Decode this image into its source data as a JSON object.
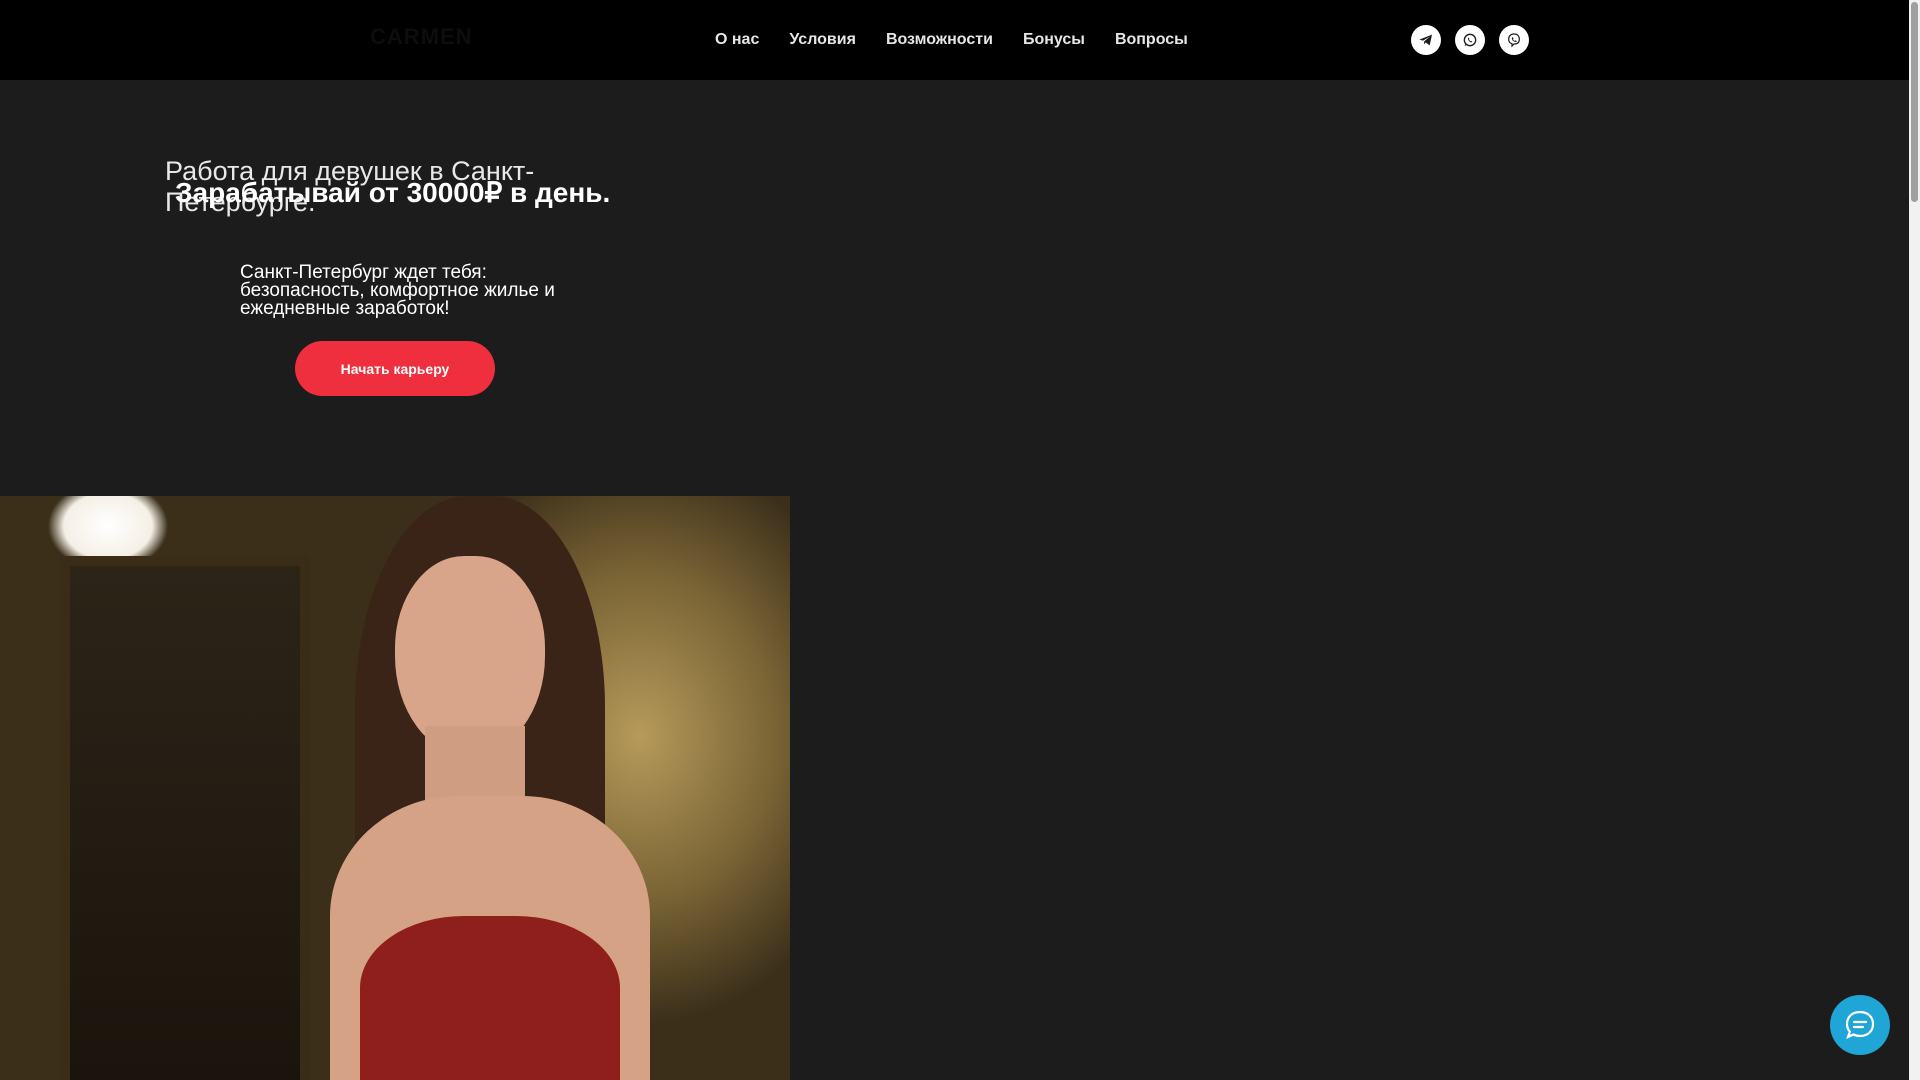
{
  "header": {
    "logo": "CARMEN",
    "nav": [
      "О нас",
      "Условия",
      "Возможности",
      "Бонусы",
      "Вопросы"
    ],
    "socials": [
      "telegram-icon",
      "whatsapp-icon",
      "viber-icon"
    ]
  },
  "hero": {
    "title": "Работа для девушек в Санкт-Петербурге.",
    "subtitle": "Зарабатывай от 30000₽ в день.",
    "text": "Санкт-Петербург ждет тебя: безопасность, комфортное жилье и ежедневные заработок!",
    "cta_label": "Начать карьеру"
  },
  "colors": {
    "background": "#1c1c1c",
    "header": "#000000",
    "accent": "#ef2f3d",
    "chat": "#1fa6d6"
  }
}
